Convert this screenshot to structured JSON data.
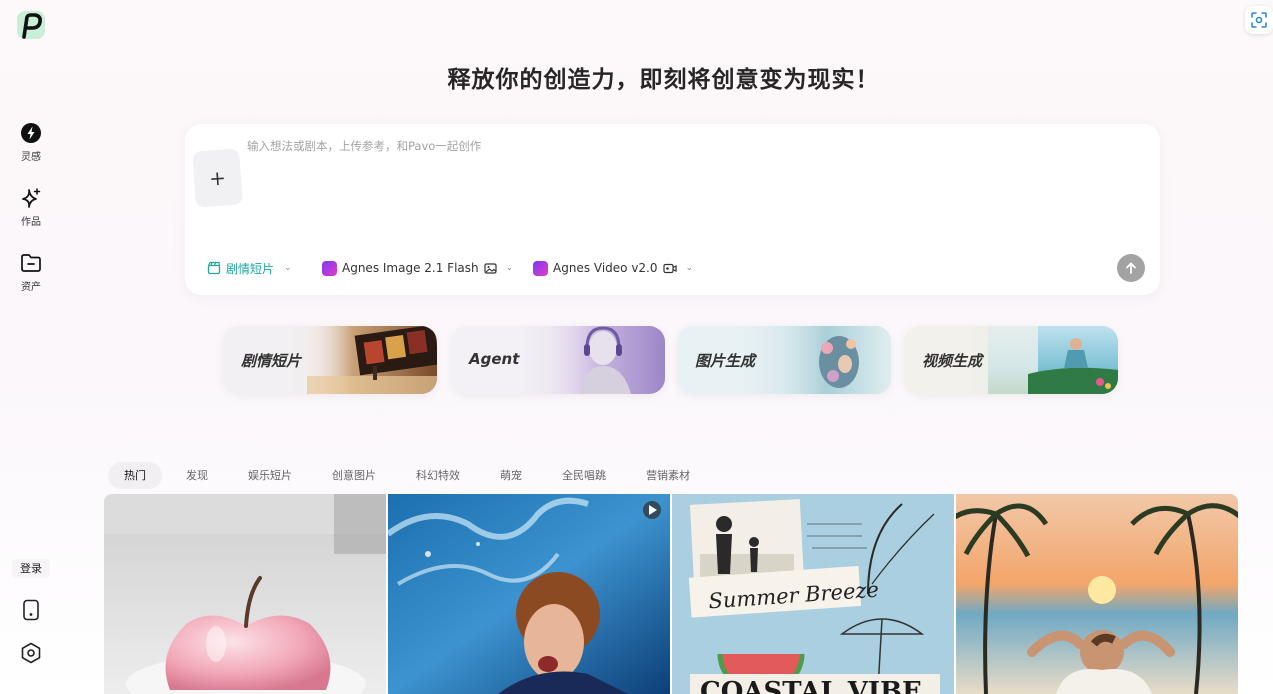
{
  "headline": "释放你的创造力，即刻将创意变为现实！",
  "sidebar": {
    "items": [
      {
        "label": "灵感",
        "icon": "lightning-icon"
      },
      {
        "label": "作品",
        "icon": "sparkle-icon"
      },
      {
        "label": "资产",
        "icon": "folder-icon"
      }
    ],
    "login_label": "登录"
  },
  "prompt": {
    "placeholder": "输入想法或剧本，上传参考，和Pavo一起创作",
    "upload_symbol": "+",
    "mode_label": "剧情短片",
    "image_model": "Agnes Image 2.1 Flash",
    "video_model": "Agnes Video v2.0"
  },
  "cards": [
    {
      "label": "剧情短片"
    },
    {
      "label": "Agent"
    },
    {
      "label": "图片生成"
    },
    {
      "label": "视频生成"
    }
  ],
  "tabs": [
    "热门",
    "发现",
    "娱乐短片",
    "创意图片",
    "科幻特效",
    "萌宠",
    "全民唱跳",
    "营销素材"
  ],
  "gallery": {
    "summer_text": "Summer Breeze",
    "coastal_text": "COASTAL VIBE"
  }
}
